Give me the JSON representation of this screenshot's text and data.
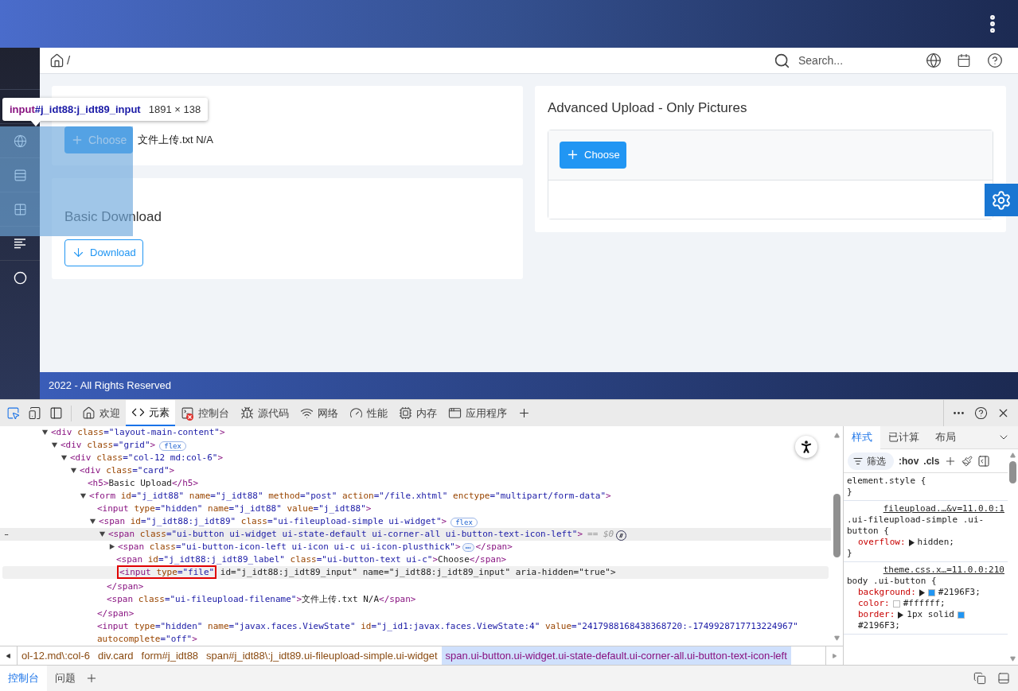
{
  "app": {
    "breadcrumb": {
      "separator": "/"
    },
    "search": {
      "placeholder": "Search..."
    },
    "cards": [
      {
        "kind": "basic_upload",
        "button": "Choose",
        "filename": "文件上传.txt N/A"
      },
      {
        "kind": "download",
        "title": "Basic Download",
        "button": "Download"
      },
      {
        "kind": "advanced_upload",
        "title": "Advanced Upload - Only Pictures",
        "button": "Choose"
      }
    ],
    "footer": "2022 - All Rights Reserved"
  },
  "inspect_tooltip": {
    "tag": "input",
    "id": "#j_idt88:j_idt89_input",
    "size": "1891 × 138"
  },
  "devtools": {
    "tabs": [
      {
        "label": "欢迎",
        "selected": false,
        "errors": false
      },
      {
        "label": "元素",
        "selected": true,
        "errors": false
      },
      {
        "label": "控制台",
        "selected": false,
        "errors": true
      },
      {
        "label": "源代码",
        "selected": false,
        "errors": false
      },
      {
        "label": "网络",
        "selected": false,
        "errors": false
      },
      {
        "label": "性能",
        "selected": false,
        "errors": false
      },
      {
        "label": "内存",
        "selected": false,
        "errors": false
      },
      {
        "label": "应用程序",
        "selected": false,
        "errors": false
      }
    ],
    "tree": [
      {
        "kind": "element",
        "code": "<div class=\"layout-main-content\">",
        "expanded": true,
        "selected": false,
        "hovered": false,
        "children": [
          {
            "kind": "element",
            "code": "<div class=\"grid\">",
            "badge": "flex",
            "expanded": true,
            "selected": false,
            "hovered": false,
            "children": [
              {
                "kind": "element",
                "code": "<div class=\"col-12 md:col-6\">",
                "expanded": true,
                "selected": false,
                "hovered": false,
                "children": [
                  {
                    "kind": "element",
                    "code": "<div class=\"card\">",
                    "expanded": true,
                    "selected": false,
                    "hovered": false,
                    "children": [
                      {
                        "kind": "leaf",
                        "code": "<h5>Basic Upload</h5>",
                        "selected": false,
                        "hovered": false
                      },
                      {
                        "kind": "element",
                        "code": "<form id=\"j_idt88\" name=\"j_idt88\" method=\"post\" action=\"/file.xhtml\" enctype=\"multipart/form-data\">",
                        "expanded": true,
                        "selected": false,
                        "hovered": false,
                        "children": [
                          {
                            "kind": "leaf",
                            "code": "<input type=\"hidden\" name=\"j_idt88\" value=\"j_idt88\">",
                            "selected": false,
                            "hovered": false
                          },
                          {
                            "kind": "element",
                            "code": "<span id=\"j_idt88:j_idt89\" class=\"ui-fileupload-simple ui-widget\">",
                            "badge": "flex",
                            "expanded": true,
                            "selected": false,
                            "hovered": false,
                            "close": "</span>",
                            "children": [
                              {
                                "kind": "element",
                                "code": "<span class=\"ui-button ui-widget ui-state-default ui-corner-all ui-button-text-icon-left\">",
                                "suffix": "== $0",
                                "expanded": true,
                                "selected": true,
                                "hovered": false,
                                "close": "</span>",
                                "children": [
                                  {
                                    "kind": "element",
                                    "code": "<span class=\"ui-button-icon-left ui-icon ui-c ui-icon-plusthick\">",
                                    "tail": "</span>",
                                    "expanded": false,
                                    "selected": false,
                                    "hovered": false
                                  },
                                  {
                                    "kind": "leaf",
                                    "code": "<span id=\"j_idt88:j_idt89_label\" class=\"ui-button-text ui-c\">Choose</span>",
                                    "selected": false,
                                    "hovered": false
                                  },
                                  {
                                    "kind": "leaf",
                                    "boxed": "<input type=\"file\"",
                                    "code": " id=\"j_idt88:j_idt89_input\" name=\"j_idt88:j_idt89_input\" aria-hidden=\"true\">",
                                    "selected": false,
                                    "hovered": true
                                  }
                                ]
                              },
                              {
                                "kind": "leaf",
                                "code": "<span class=\"ui-fileupload-filename\">文件上传.txt N/A</span>",
                                "selected": false,
                                "hovered": false
                              }
                            ]
                          },
                          {
                            "kind": "leaf",
                            "code": "<input type=\"hidden\" name=\"javax.faces.ViewState\" id=\"j_id1:javax.faces.ViewState:4\" value=\"2417988168438368720:-1749928717713224967\" autocomplete=\"off\">",
                            "selected": false,
                            "hovered": false
                          }
                        ]
                      }
                    ]
                  }
                ]
              }
            ]
          }
        ]
      }
    ],
    "crumbs": [
      {
        "label": "ol-12.md\\:col-6",
        "selected": false
      },
      {
        "label": "div.card",
        "selected": false
      },
      {
        "label": "form#j_idt88",
        "selected": false
      },
      {
        "label": "span#j_idt88\\:j_idt89.ui-fileupload-simple.ui-widget",
        "selected": false
      },
      {
        "label": "span.ui-button.ui-widget.ui-state-default.ui-corner-all.ui-button-text-icon-left",
        "selected": true
      }
    ],
    "styles": {
      "tabs": [
        {
          "label": "样式",
          "selected": true
        },
        {
          "label": "已计算",
          "selected": false
        },
        {
          "label": "布局",
          "selected": false
        }
      ],
      "filter": {
        "placeholder": "筛选"
      },
      "hov": ":hov",
      "cls": ".cls",
      "rules": [
        {
          "selector": "element.style {",
          "close": "}"
        },
        {
          "selector": ".ui-fileupload-simple .ui-button {",
          "source": "fileupload.…&v=11.0.0:1",
          "props": [
            {
              "name": "overflow:",
              "expandable": true,
              "text": "hidden;"
            }
          ],
          "close": "}"
        },
        {
          "selector": "body .ui-button {",
          "source": "theme.css.x…=11.0.0:210",
          "props": [
            {
              "name": "background:",
              "expandable": true,
              "color": "#2196f3",
              "color_text": "#2196F3;"
            },
            {
              "name": "color:",
              "expandable": false,
              "color": "#ffffff",
              "color_text": "#ffffff;"
            },
            {
              "name": "border:",
              "expandable": true,
              "text": "1px solid",
              "color": "#2196f3",
              "color_text": "#2196F3;"
            }
          ]
        }
      ]
    },
    "drawer": [
      {
        "label": "控制台",
        "selected": true
      },
      {
        "label": "问题",
        "selected": false
      }
    ]
  }
}
